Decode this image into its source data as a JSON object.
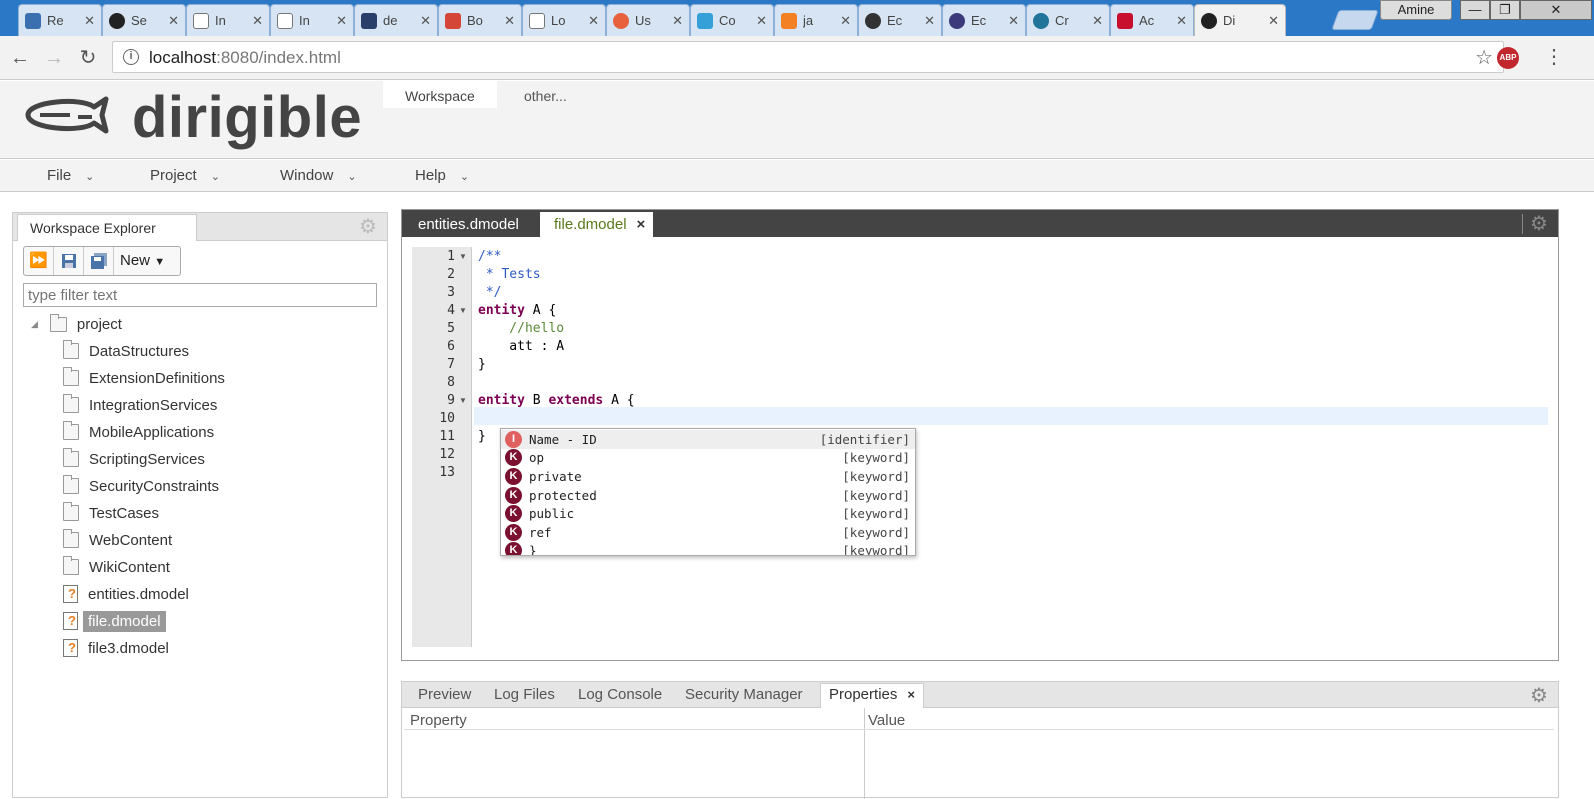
{
  "browser": {
    "tabs": [
      {
        "title": "Re",
        "favicon": "#3a6fb0"
      },
      {
        "title": "Se",
        "favicon": "#222222"
      },
      {
        "title": "In",
        "favicon": "#ffffff"
      },
      {
        "title": "In",
        "favicon": "#ffffff"
      },
      {
        "title": "de",
        "favicon": "#2a3f6a"
      },
      {
        "title": "Bo",
        "favicon": "#d44638"
      },
      {
        "title": "Lo",
        "favicon": "#ffffff"
      },
      {
        "title": "Us",
        "favicon": "#e8623e"
      },
      {
        "title": "Co",
        "favicon": "#35a0d8"
      },
      {
        "title": "ja",
        "favicon": "#f48024"
      },
      {
        "title": "Ec",
        "favicon": "#333333"
      },
      {
        "title": "Ec",
        "favicon": "#3c3a7a"
      },
      {
        "title": "Cr",
        "favicon": "#21759b"
      },
      {
        "title": "Ac",
        "favicon": "#c8102e"
      },
      {
        "title": "Di",
        "favicon": "#222222",
        "active": true
      }
    ],
    "close_glyph": "✕",
    "user": "Amine",
    "window_controls": {
      "minimize": "—",
      "maximize": "❐",
      "close": "✕"
    },
    "url_host": "localhost",
    "url_rest": ":8080/index.html",
    "info_glyph": "i",
    "abp_label": "ABP"
  },
  "app": {
    "logo_text": "dirigible",
    "perspectives": [
      "Workspace",
      "other..."
    ],
    "menus": [
      "File",
      "Project",
      "Window",
      "Help"
    ]
  },
  "workspace": {
    "title": "Workspace Explorer",
    "new_label": "New",
    "filter_placeholder": "type filter text",
    "project": "project",
    "folders": [
      "DataStructures",
      "ExtensionDefinitions",
      "IntegrationServices",
      "MobileApplications",
      "ScriptingServices",
      "SecurityConstraints",
      "TestCases",
      "WebContent",
      "WikiContent"
    ],
    "files": [
      "entities.dmodel",
      "file.dmodel",
      "file3.dmodel"
    ],
    "selected_file": "file.dmodel"
  },
  "editor": {
    "tabs": [
      "entities.dmodel",
      "file.dmodel"
    ],
    "active_tab": "file.dmodel",
    "close_glyph": "×",
    "line_numbers": [
      "1",
      "2",
      "3",
      "4",
      "5",
      "6",
      "7",
      "8",
      "9",
      "10",
      "11",
      "12",
      "13"
    ],
    "code": {
      "l1": "/**",
      "l2": " * Tests",
      "l3": " */",
      "l4_kw": "entity",
      "l4_rest": " A {",
      "l5": "    //hello",
      "l6": "    att : A",
      "l7": "}",
      "l9_kw1": "entity",
      "l9_mid": " B ",
      "l9_kw2": "extends",
      "l9_rest": " A {",
      "l11": "}"
    }
  },
  "autocomplete": {
    "items": [
      {
        "badge": "I",
        "label": "Name - ID",
        "type": "[identifier]"
      },
      {
        "badge": "K",
        "label": "op",
        "type": "[keyword]"
      },
      {
        "badge": "K",
        "label": "private",
        "type": "[keyword]"
      },
      {
        "badge": "K",
        "label": "protected",
        "type": "[keyword]"
      },
      {
        "badge": "K",
        "label": "public",
        "type": "[keyword]"
      },
      {
        "badge": "K",
        "label": "ref",
        "type": "[keyword]"
      },
      {
        "badge": "K",
        "label": "}",
        "type": "[keyword]"
      }
    ]
  },
  "bottom": {
    "tabs": [
      "Preview",
      "Log Files",
      "Log Console",
      "Security Manager",
      "Properties"
    ],
    "active_tab": "Properties",
    "close_glyph": "×",
    "columns": [
      "Property",
      "Value"
    ]
  },
  "colors": {
    "chrome_tabstrip": "#2b78c6",
    "editor_tabbar": "#444444",
    "active_tab_text": "#5a7a1a",
    "keyword": "#7b0052",
    "comment": "#2f5bc0"
  }
}
